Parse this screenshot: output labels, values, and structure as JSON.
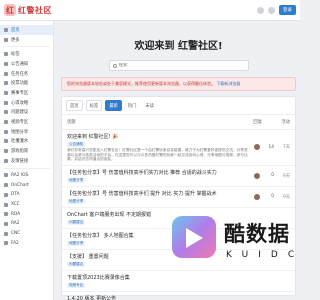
{
  "header": {
    "logo_text": "红警社区",
    "logo_glyph": "红",
    "login_label": "登录"
  },
  "sidebar": {
    "items": [
      {
        "label": "首页",
        "active": true
      },
      {
        "label": "更多"
      },
      {
        "label": "标签"
      },
      {
        "label": "公告通知"
      },
      {
        "label": "任务任务"
      },
      {
        "label": "投票功能"
      },
      {
        "label": "赛事专区"
      },
      {
        "label": "心得攻略"
      },
      {
        "label": "问题建议"
      },
      {
        "label": "视频专区"
      },
      {
        "label": "地图分享"
      },
      {
        "label": "吐槽灌水"
      },
      {
        "label": "游戏指南"
      },
      {
        "label": "友情链接"
      },
      {
        "label": "RA2 IOS"
      },
      {
        "label": "OnChart"
      },
      {
        "label": "DTA"
      },
      {
        "label": "XCC"
      },
      {
        "label": "RDA"
      },
      {
        "label": "RA2"
      },
      {
        "label": "CNC"
      },
      {
        "label": "FA2"
      }
    ]
  },
  "hero": {
    "title": "欢迎来到 红警社区!"
  },
  "search": {
    "placeholder": "搜索"
  },
  "notice": {
    "text": "您的浏览器版本较低或处于兼容模式，推荐使用更新版本浏览器，以获得最佳体验。",
    "link": "下载新浏览器"
  },
  "tabs": [
    {
      "label": "首页",
      "active": false
    },
    {
      "label": "标签",
      "active": false
    },
    {
      "label": "最新",
      "active": true
    },
    {
      "label": "热门",
      "active": false
    },
    {
      "label": "未读",
      "active": false
    }
  ],
  "table": {
    "headers": [
      "话题",
      "回复",
      "活动"
    ],
    "rows": [
      {
        "title": "欢迎来到 红警社区! 🎉",
        "meta": "公告通知",
        "excerpt": "我们非常高兴您能加入红警社区！红警社区是一个由红警玩家自发组建，致力于为红警爱好者提供交流、分享资源以及参与各类活动的平台。在这里您可以与众多热爱红警的玩家一起交流游戏心得、分享地图与视频、参与比赛，并结识志同道合的朋友。",
        "replies": "14",
        "time": "7天"
      },
      {
        "title": "【任务包分享】号 伤害值科技高手们实力对比  推荐 合适的战斗实力",
        "meta": "地图分享",
        "excerpt": "",
        "replies": "0",
        "time": "9天"
      },
      {
        "title": "【任务包分享】号 伤害值科技高手们  提升 对比 实力 提升  掌握战术",
        "meta": "地图分享",
        "excerpt": "",
        "replies": "0",
        "time": "9天"
      },
      {
        "title": "OnChart 客户端服务出现 不定期报错",
        "meta": "问题建议",
        "excerpt": "",
        "replies": "",
        "time": ""
      },
      {
        "title": "【任务包分享】 多人地图合集",
        "meta": "地图分享",
        "excerpt": "",
        "replies": "",
        "time": ""
      },
      {
        "title": "【支援】 重置问题",
        "meta": "问题建议",
        "excerpt": "",
        "replies": "",
        "time": ""
      },
      {
        "title": "下载置顶2023比赛录像合集",
        "meta": "视频专区",
        "excerpt": "",
        "replies": "",
        "time": ""
      },
      {
        "title": "1.4.20 版本 更新公告",
        "meta": "",
        "excerpt": "",
        "replies": "",
        "time": ""
      }
    ]
  },
  "watermark": {
    "text": "酷数据",
    "sub": "KUIDC"
  },
  "colors": {
    "accent": "#2e7bcf",
    "brand": "#d23a3a",
    "notice_bg": "#fbe9ea"
  }
}
